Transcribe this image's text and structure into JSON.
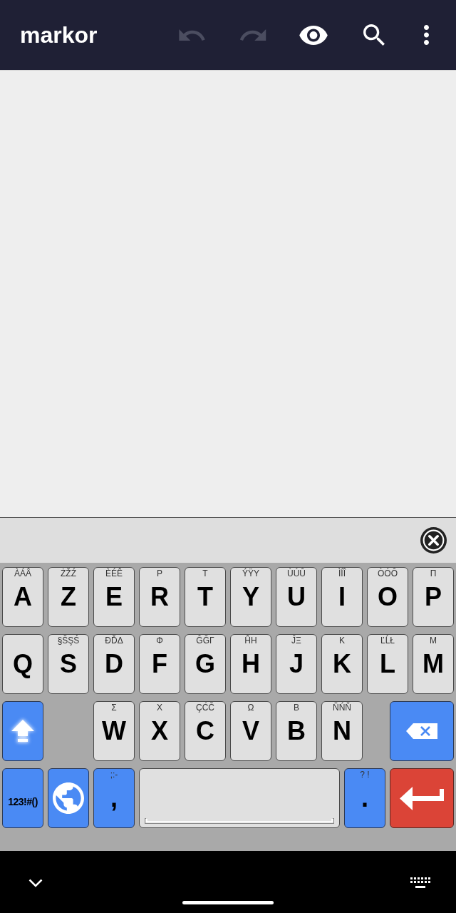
{
  "app_bar": {
    "title": "markor",
    "actions": [
      {
        "kind": "undo",
        "disabled": true
      },
      {
        "kind": "redo",
        "disabled": true
      },
      {
        "kind": "preview",
        "disabled": false
      },
      {
        "kind": "search",
        "disabled": false
      },
      {
        "kind": "more",
        "disabled": false
      }
    ]
  },
  "keyboard": {
    "shift_on": true,
    "rows": [
      {
        "keys": [
          {
            "kind": "letter",
            "label": "A",
            "hint": "ÀÁÂ"
          },
          {
            "kind": "letter",
            "label": "Z",
            "hint": "ŻŽŹ"
          },
          {
            "kind": "letter",
            "label": "E",
            "hint": "ÈÉÊ"
          },
          {
            "kind": "letter",
            "label": "R",
            "hint": "Ρ"
          },
          {
            "kind": "letter",
            "label": "T",
            "hint": "Τ"
          },
          {
            "kind": "letter",
            "label": "Y",
            "hint": "ÝŸΥ"
          },
          {
            "kind": "letter",
            "label": "U",
            "hint": "ÙÚÛ"
          },
          {
            "kind": "letter",
            "label": "I",
            "hint": "ÌÍÎ"
          },
          {
            "kind": "letter",
            "label": "O",
            "hint": "ÒÓÔ"
          },
          {
            "kind": "letter",
            "label": "P",
            "hint": "Π"
          }
        ]
      },
      {
        "keys": [
          {
            "kind": "letter",
            "label": "Q"
          },
          {
            "kind": "letter",
            "label": "S",
            "hint": "§ŠŞŚ"
          },
          {
            "kind": "letter",
            "label": "D",
            "hint": "ĐĎΔ"
          },
          {
            "kind": "letter",
            "label": "F",
            "hint": "Φ"
          },
          {
            "kind": "letter",
            "label": "G",
            "hint": "ĜĞΓ"
          },
          {
            "kind": "letter",
            "label": "H",
            "hint": "ĤΗ"
          },
          {
            "kind": "letter",
            "label": "J",
            "hint": "ĴΞ"
          },
          {
            "kind": "letter",
            "label": "K",
            "hint": "Κ"
          },
          {
            "kind": "letter",
            "label": "L",
            "hint": "ĽĹŁ"
          },
          {
            "kind": "letter",
            "label": "M",
            "hint": "Μ"
          }
        ]
      },
      {
        "keys": [
          {
            "kind": "shift"
          },
          {
            "kind": "letter",
            "label": "W",
            "hint": "Σ"
          },
          {
            "kind": "letter",
            "label": "X",
            "hint": "Χ"
          },
          {
            "kind": "letter",
            "label": "C",
            "hint": "ÇĆČ"
          },
          {
            "kind": "letter",
            "label": "V",
            "hint": "Ω"
          },
          {
            "kind": "letter",
            "label": "B",
            "hint": "Β"
          },
          {
            "kind": "letter",
            "label": "N",
            "hint": "ÑŃŇ"
          },
          {
            "kind": "backspace"
          }
        ]
      },
      {
        "keys": [
          {
            "kind": "symbols",
            "label": "123!#()"
          },
          {
            "kind": "language"
          },
          {
            "kind": "punctuation",
            "label": ",",
            "hint": ";:-"
          },
          {
            "kind": "space"
          },
          {
            "kind": "punctuation",
            "label": ".",
            "hint": "? !"
          },
          {
            "kind": "enter"
          }
        ]
      }
    ]
  }
}
